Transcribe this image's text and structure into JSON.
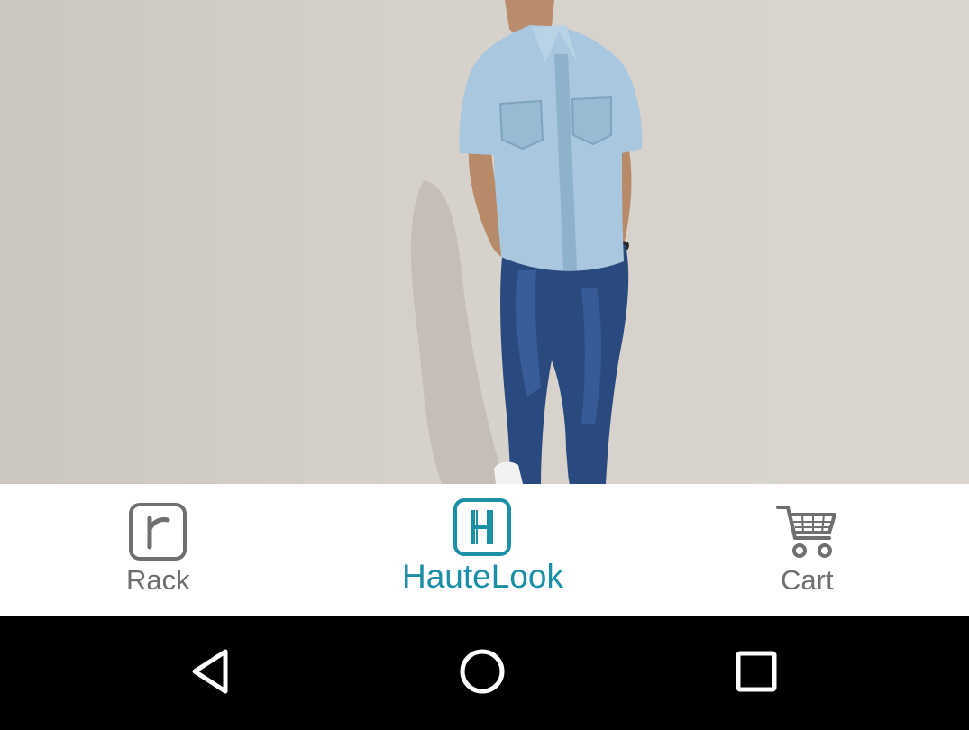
{
  "hero": {
    "image_icon": "model-denim-shirt-jeans-photo"
  },
  "tabs": {
    "rack": {
      "label": "Rack",
      "icon": "rack-r-icon",
      "selected": false
    },
    "hautelook": {
      "label": "HauteLook",
      "icon": "hautelook-h-icon",
      "selected": true
    },
    "cart": {
      "label": "Cart",
      "icon": "cart-icon",
      "selected": false
    }
  },
  "colors": {
    "accent": "#1a8fa6",
    "inactive": "#6f6f6f",
    "tabbar_bg": "#ffffff",
    "navbar_bg": "#000000"
  },
  "navbar": {
    "back_icon": "back-triangle-icon",
    "home_icon": "home-circle-icon",
    "recents_icon": "recents-square-icon"
  }
}
